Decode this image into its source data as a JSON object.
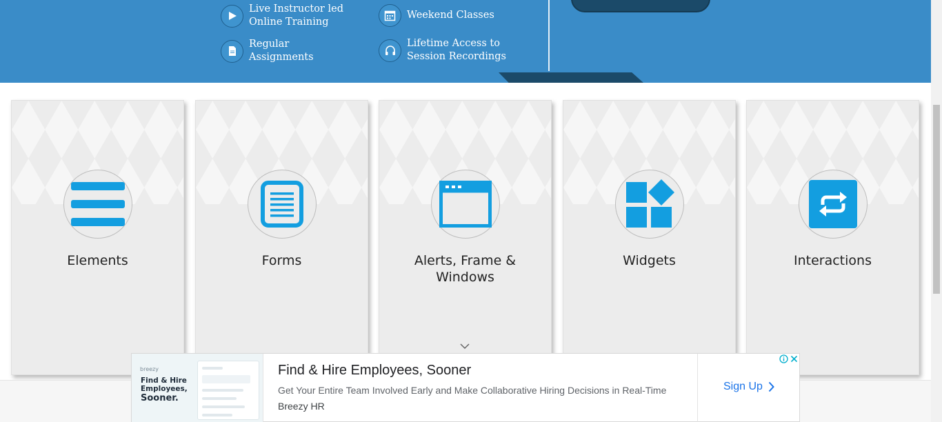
{
  "banner": {
    "features": [
      {
        "icon": "play-icon",
        "line1": "Live Instructor led",
        "line2": "Online Training"
      },
      {
        "icon": "calendar-icon",
        "line1": "Weekend Classes",
        "line2": ""
      },
      {
        "icon": "document-icon",
        "line1": "Regular",
        "line2": "Assignments"
      },
      {
        "icon": "headphones-icon",
        "line1": "Lifetime Access to",
        "line2": "Session Recordings"
      }
    ]
  },
  "cards": [
    {
      "title": "Elements",
      "icon": "hamburger-menu-icon"
    },
    {
      "title": "Forms",
      "icon": "form-document-icon"
    },
    {
      "title": "Alerts, Frame &",
      "title2": "Windows",
      "icon": "browser-window-icon"
    },
    {
      "title": "Widgets",
      "icon": "widgets-grid-icon"
    },
    {
      "title": "Interactions",
      "icon": "repeat-arrows-icon"
    }
  ],
  "ad": {
    "image": {
      "brand": "breezy",
      "line1": "Find & Hire",
      "line2": "Employees,",
      "line3": "Sooner."
    },
    "headline": "Find & Hire Employees, Sooner",
    "description": "Get Your Entire Team Involved Early and Make Collaborative Hiring Decisions in Real-Time",
    "advertiser": "Breezy HR",
    "cta": "Sign Up"
  },
  "colors": {
    "banner": "#3a8cc8",
    "accent": "#1b4a69",
    "icon_blue": "#139ee0"
  }
}
